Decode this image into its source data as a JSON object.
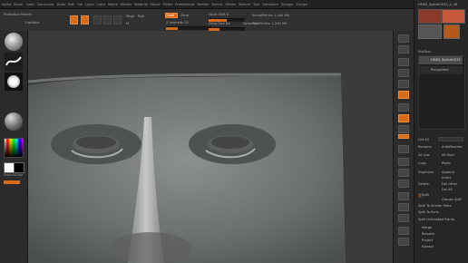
{
  "menu": [
    "Alpha",
    "Brush",
    "Color",
    "Document",
    "Draw",
    "Edit",
    "File",
    "Layer",
    "Light",
    "Macro",
    "Marker",
    "Material",
    "Movie",
    "Picker",
    "Preferences",
    "Render",
    "Stencil",
    "Stroke",
    "Texture",
    "Tool",
    "Transform",
    "Zplugin",
    "Zscript"
  ],
  "toolbar": {
    "projection": "Projection Master",
    "lightbox": "LightBox",
    "edit": "Edit",
    "draw": "Draw",
    "move": "Move",
    "scale": "Scale",
    "rotate": "Rotate",
    "mrgb": "Mrgb",
    "rgb": "Rgb",
    "m": "M",
    "zadd": "Zadd",
    "zsub": "Zsub",
    "rgb_intensity": "Rgb Intensity 100",
    "z_intensity": "Z Intensity 25",
    "focal_shift": "Focal Shift 0",
    "draw_size": "Draw Size 64",
    "dynamic": "Dynamic",
    "active_points": "ActivePoints: 1.244 Mil",
    "total_points": "TotalPoints: 1.244 Mil"
  },
  "left": {
    "brush": "Standard",
    "stroke": "FreeHand",
    "alpha": "Alpha Off",
    "material": "MatCap Gray",
    "gradient": "Gradient",
    "switch": "SwitchColor",
    "alternate": "Alternate"
  },
  "right": {
    "tool_name": "HEAD_SplineUV33_4_48",
    "subtool_header": "SubTool",
    "subtool_1": "HEAD_SplineUV33",
    "subtool_2": "Polysphere",
    "list_all": "List All",
    "new_folder": "New Folder",
    "rename": "Rename",
    "auto_reorder": "AutoReorder",
    "all_low": "All Low",
    "all_high": "All High",
    "copy": "Copy",
    "paste": "Paste",
    "append": "Append",
    "insert": "Insert",
    "duplicate": "Duplicate",
    "delete": "Delete",
    "del_other": "Del Other",
    "del_all": "Del All",
    "split": "Split",
    "groups_split": "Groups Split",
    "split_similar": "Split To Similar Parts",
    "split_parts": "Split To Parts",
    "split_unmasked": "Split Unmasked Points",
    "merge": "Merge",
    "remesh": "Remesh",
    "project": "Project",
    "extract": "Extract"
  }
}
